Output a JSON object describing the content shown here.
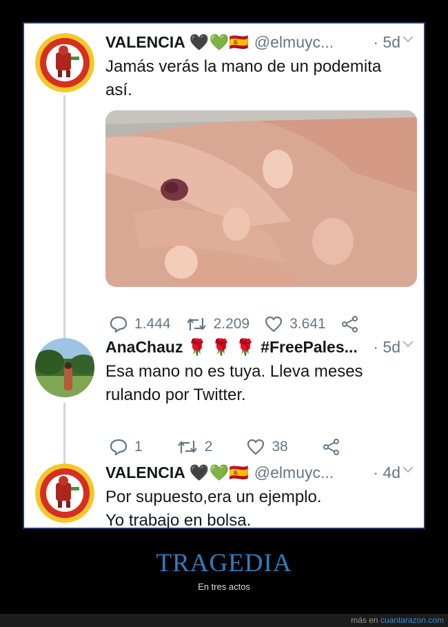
{
  "tweets": [
    {
      "name": "VALENCIA",
      "emojis": "🖤💚🇪🇸",
      "handle": "@elmuyc...",
      "time": "· 5d",
      "text_lines": [
        "Jamás verás la mano de un podemita",
        "así."
      ],
      "counts": {
        "replies": "1.444",
        "retweets": "2.209",
        "likes": "3.641"
      }
    },
    {
      "name": "AnaChauz",
      "emojis": "🌹 🌹 🌹",
      "hashtag": "#FreePales...",
      "time": "· 5d",
      "text_lines": [
        "Esa mano no es tuya. Lleva meses",
        "rulando por Twitter."
      ],
      "counts": {
        "replies": "1",
        "retweets": "2",
        "likes": "38"
      }
    },
    {
      "name": "VALENCIA",
      "emojis": "🖤💚🇪🇸",
      "handle": "@elmuyc...",
      "time": "· 4d",
      "text_lines": [
        "Por supuesto,era un ejemplo.",
        "Yo trabajo en bolsa."
      ]
    }
  ],
  "footer": {
    "title": "TRAGEDIA",
    "subtitle": "En tres actos",
    "credit_prefix": "más en",
    "credit_site": "cuantarazon.com"
  },
  "colors": {
    "frame_border": "#1f3a66",
    "title_blue": "#2d7fc1",
    "meta_gray": "#657786"
  },
  "icons": [
    "reply-icon",
    "retweet-icon",
    "like-icon",
    "share-icon",
    "chevron-down-icon",
    "rose-icon",
    "black-heart-icon",
    "green-heart-icon",
    "spain-flag-icon"
  ]
}
